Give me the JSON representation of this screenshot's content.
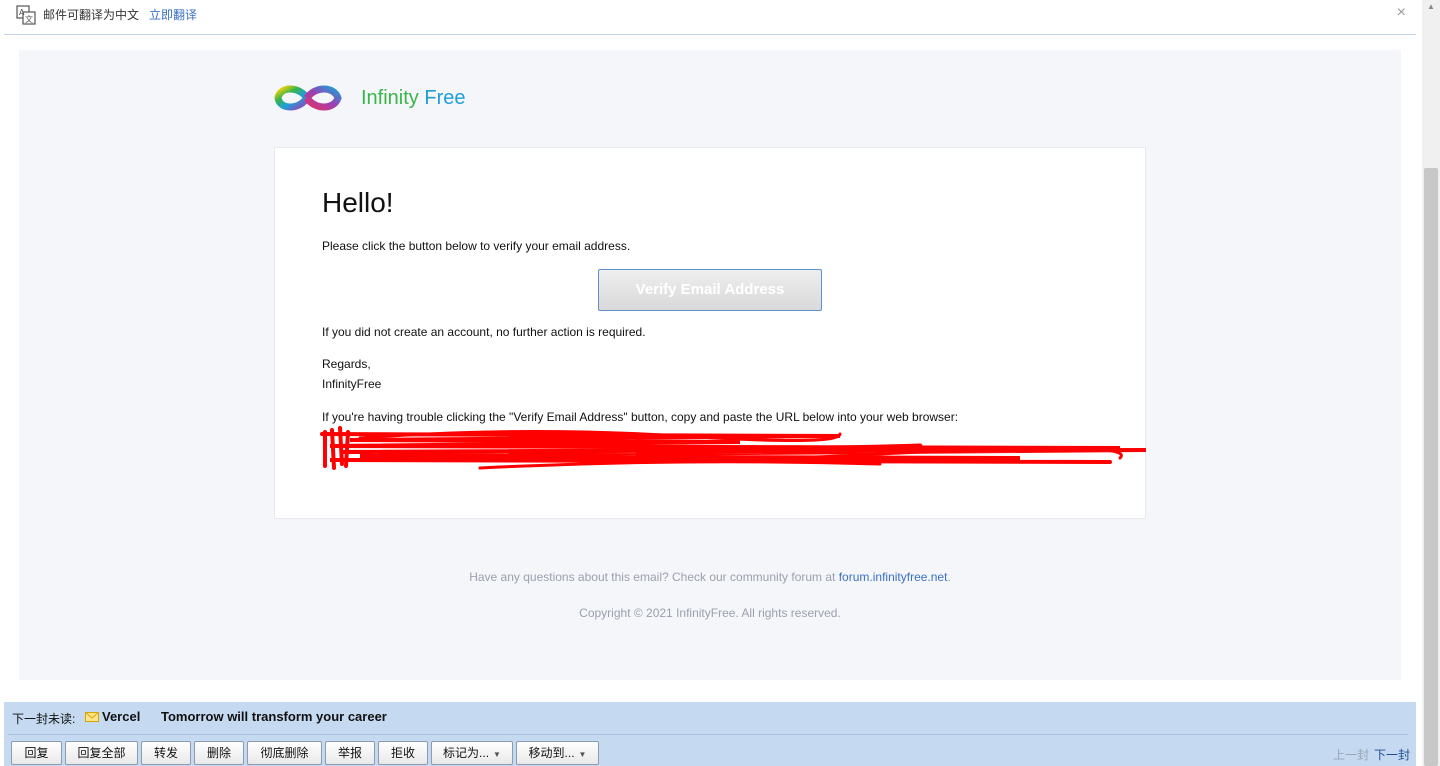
{
  "translate_bar": {
    "text": "邮件可翻译为中文",
    "link": "立即翻译",
    "close": "×"
  },
  "email": {
    "logo": {
      "word1": "Infinity",
      "word2": "Free",
      "color1": "#39b54a",
      "color2": "#1e9fd8"
    },
    "heading": "Hello!",
    "intro": "Please click the button below to verify your email address.",
    "button_label": "Verify Email Address",
    "no_action": "If you did not create an account, no further action is required.",
    "regards": "Regards,",
    "signature": "InfinityFree",
    "trouble": "If you're having trouble clicking the \"Verify Email Address\" button, copy and paste the URL below into your web browser:",
    "footer_question": "Have any questions about this email? Check our community forum at ",
    "footer_link": "forum.infinityfree.net",
    "footer_period": ".",
    "copyright": "Copyright © 2021 InfinityFree. All rights reserved."
  },
  "bottom": {
    "next_unread_label": "下一封未读:",
    "next_sender": "Vercel",
    "next_subject": "Tomorrow will transform your career",
    "buttons": {
      "reply": "回复",
      "reply_all": "回复全部",
      "forward": "转发",
      "delete": "删除",
      "delete_permanent": "彻底删除",
      "report": "举报",
      "reject": "拒收",
      "mark_as": "标记为...",
      "move_to": "移动到..."
    },
    "prev": "上一封",
    "next": "下一封"
  }
}
